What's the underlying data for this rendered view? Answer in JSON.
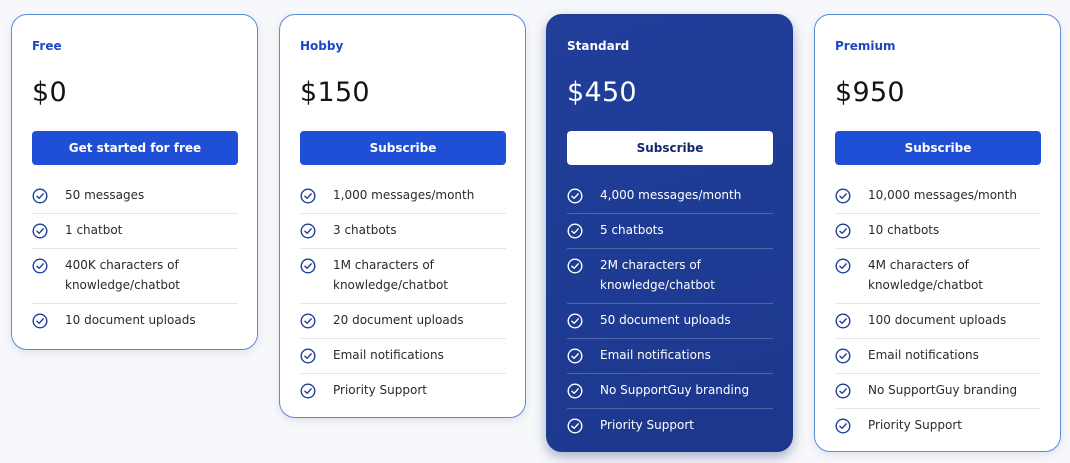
{
  "colors": {
    "accent": "#1f4fd6",
    "featured_background": "#1e3b93",
    "card_border": "#5b8bd6"
  },
  "plans": [
    {
      "name": "Free",
      "price": "$0",
      "cta": "Get started for free",
      "features": [
        "50 messages",
        "1 chatbot",
        "400K characters of knowledge/chatbot",
        "10 document uploads"
      ]
    },
    {
      "name": "Hobby",
      "price": "$150",
      "cta": "Subscribe",
      "features": [
        "1,000 messages/month",
        "3 chatbots",
        "1M characters of knowledge/chatbot",
        "20 document uploads",
        "Email notifications",
        "Priority Support"
      ]
    },
    {
      "name": "Standard",
      "price": "$450",
      "cta": "Subscribe",
      "features": [
        "4,000 messages/month",
        "5 chatbots",
        "2M characters of knowledge/chatbot",
        "50 document uploads",
        "Email notifications",
        "No SupportGuy branding",
        "Priority Support"
      ]
    },
    {
      "name": "Premium",
      "price": "$950",
      "cta": "Subscribe",
      "features": [
        "10,000 messages/month",
        "10 chatbots",
        "4M characters of knowledge/chatbot",
        "100 document uploads",
        "Email notifications",
        "No SupportGuy branding",
        "Priority Support"
      ]
    }
  ],
  "icons": {
    "feature_check": "check-circle-icon"
  }
}
